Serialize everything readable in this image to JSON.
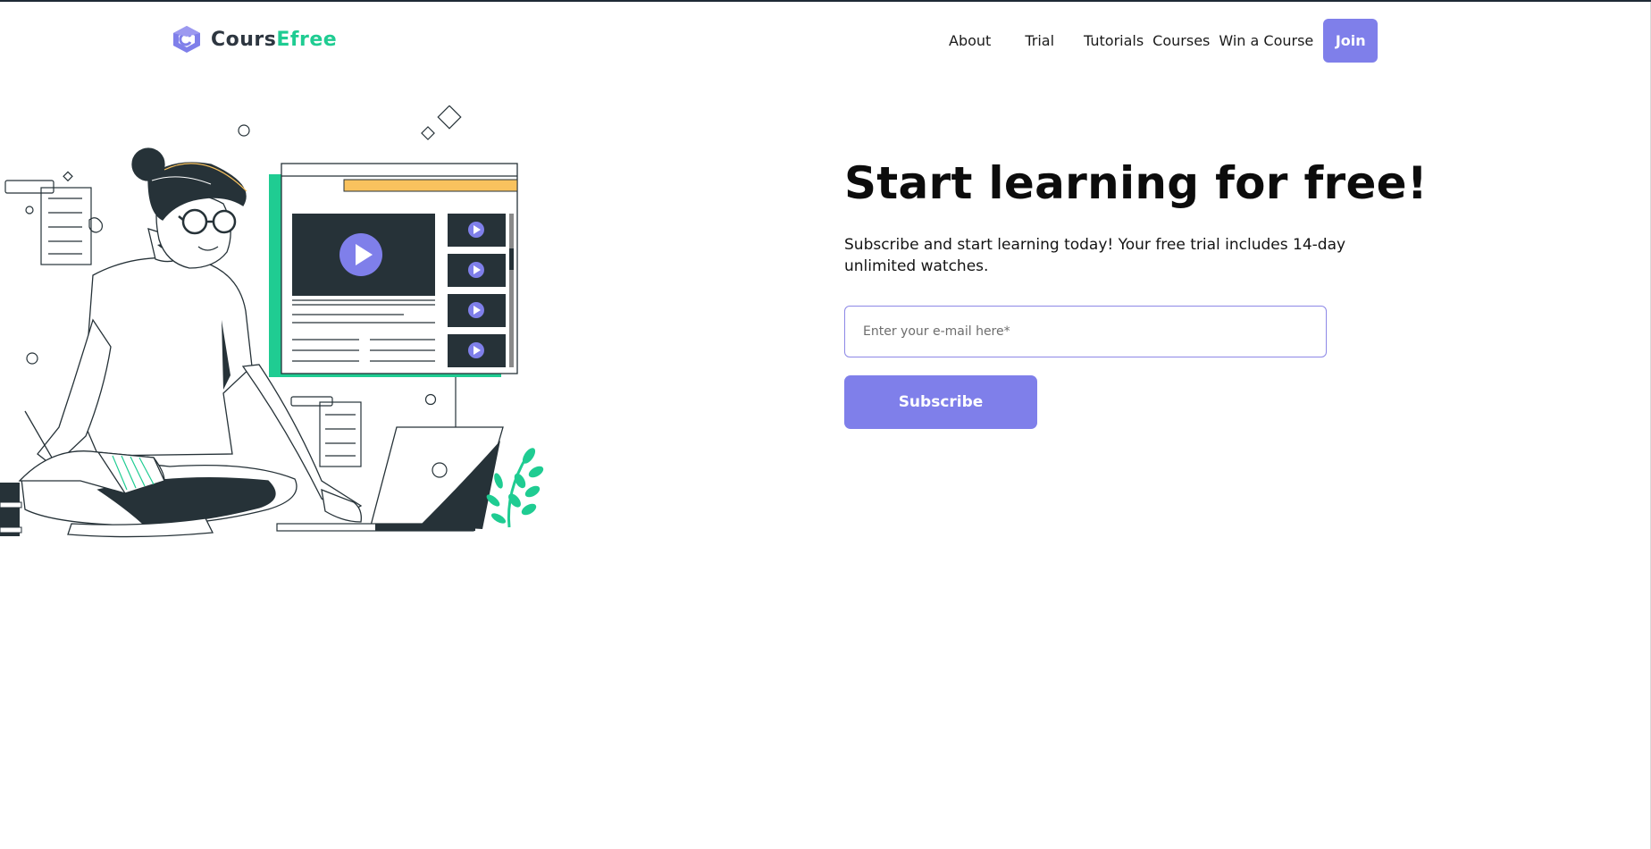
{
  "brand": {
    "name_primary": "Cours",
    "name_accent": "Efree"
  },
  "nav": {
    "items": [
      {
        "label": "About"
      },
      {
        "label": "Trial"
      },
      {
        "label": "Tutorials"
      },
      {
        "label": "Courses"
      },
      {
        "label": "Win a Course"
      }
    ],
    "join_label": "Join"
  },
  "hero": {
    "title": "Start learning for free!",
    "subtitle": "Subscribe and start learning today! Your free trial includes 14-day unlimited watches.",
    "email_placeholder": "Enter your e-mail here*",
    "subscribe_label": "Subscribe"
  },
  "colors": {
    "accent": "#7f7fea",
    "brand_green": "#1fcc92",
    "dark": "#263238",
    "highlight": "#f9c25e"
  },
  "icons": [
    "graduation-cap-logo-icon",
    "play-icon"
  ]
}
